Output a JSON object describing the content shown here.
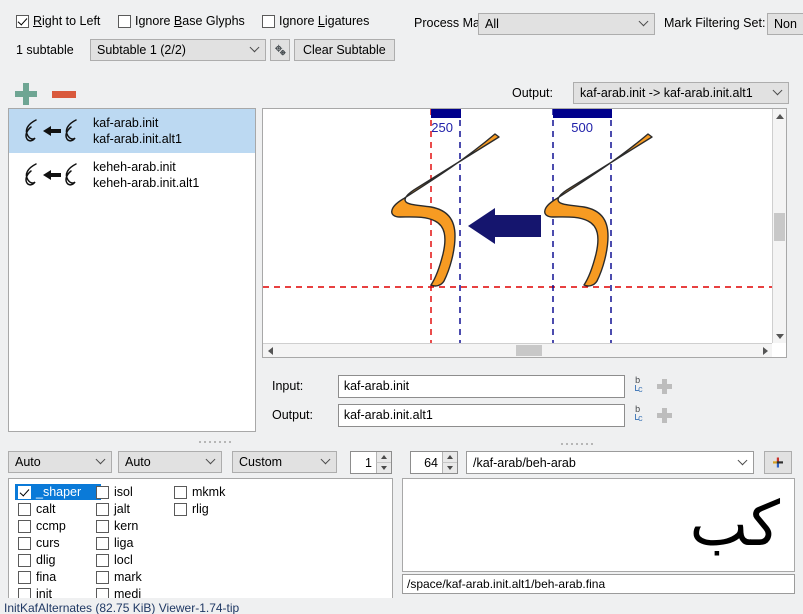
{
  "top": {
    "right_to_left": {
      "label": "Right to Left",
      "checked": true,
      "accel": "R"
    },
    "ignore_base_glyphs": {
      "label": "Ignore Base Glyphs",
      "checked": false,
      "accel": "B"
    },
    "ignore_ligatures": {
      "label": "Ignore Ligatures",
      "checked": false,
      "accel": "L"
    },
    "process_marks_label": "Process Marks:",
    "process_marks_value": "All",
    "mark_filtering_label": "Mark Filtering Set:",
    "mark_filtering_value": "Non",
    "subtable_count_label": "1 subtable",
    "subtable_value": "Subtable 1 (2/2)",
    "subtable_settings_icon": "gears-icon",
    "clear_subtable_label": "Clear Subtable"
  },
  "list": {
    "add_icon": "plus-icon",
    "remove_icon": "minus-icon",
    "rows": [
      {
        "input": "kaf-arab.init",
        "output": "kaf-arab.init.alt1",
        "selected": true
      },
      {
        "input": "keheh-arab.init",
        "output": "keheh-arab.init.alt1",
        "selected": false
      }
    ]
  },
  "output_selector": {
    "label": "Output:",
    "value": "kaf-arab.init -> kaf-arab.init.alt1"
  },
  "canvas": {
    "metric_left_label": "250",
    "metric_right_label": "500",
    "baseline_color": "#e00000",
    "metric_color": "#00008b",
    "glyph_color": "#f79b22",
    "arrow_color": "#1b1b7a"
  },
  "io": {
    "input_label": "Input:",
    "input_value": "kaf-arab.init",
    "output_label": "Output:",
    "output_value": "kaf-arab.init.alt1",
    "helper_icon": "bc-glyph-icon",
    "add_icon": "plus-icon"
  },
  "bottombar": {
    "script_value": "Auto",
    "language_value": "Auto",
    "direction_value": "Custom",
    "feature_index_value": "1",
    "size_value": "64",
    "glyph_path_value": "/kaf-arab/beh-arab",
    "add_button_label": "+"
  },
  "features": {
    "columns": [
      [
        {
          "label": "_shaper",
          "checked": true,
          "selected": true
        },
        {
          "label": "calt",
          "checked": false,
          "selected": false
        },
        {
          "label": "ccmp",
          "checked": false,
          "selected": false
        },
        {
          "label": "curs",
          "checked": false,
          "selected": false
        },
        {
          "label": "dlig",
          "checked": false,
          "selected": false
        },
        {
          "label": "fina",
          "checked": false,
          "selected": false
        },
        {
          "label": "init",
          "checked": false,
          "selected": false
        }
      ],
      [
        {
          "label": "isol",
          "checked": false,
          "selected": false
        },
        {
          "label": "jalt",
          "checked": false,
          "selected": false
        },
        {
          "label": "kern",
          "checked": false,
          "selected": false
        },
        {
          "label": "liga",
          "checked": false,
          "selected": false
        },
        {
          "label": "locl",
          "checked": false,
          "selected": false
        },
        {
          "label": "mark",
          "checked": false,
          "selected": false
        },
        {
          "label": "medi",
          "checked": false,
          "selected": false
        }
      ],
      [
        {
          "label": "mkmk",
          "checked": false,
          "selected": false
        },
        {
          "label": "rlig",
          "checked": false,
          "selected": false
        }
      ]
    ]
  },
  "preview": {
    "arabic_text": "كب",
    "path_value": "/space/kaf-arab.init.alt1/beh-arab.fina"
  },
  "status": {
    "text": "InitKafAlternates (82.75 KiB) Viewer-1.74-tip"
  }
}
